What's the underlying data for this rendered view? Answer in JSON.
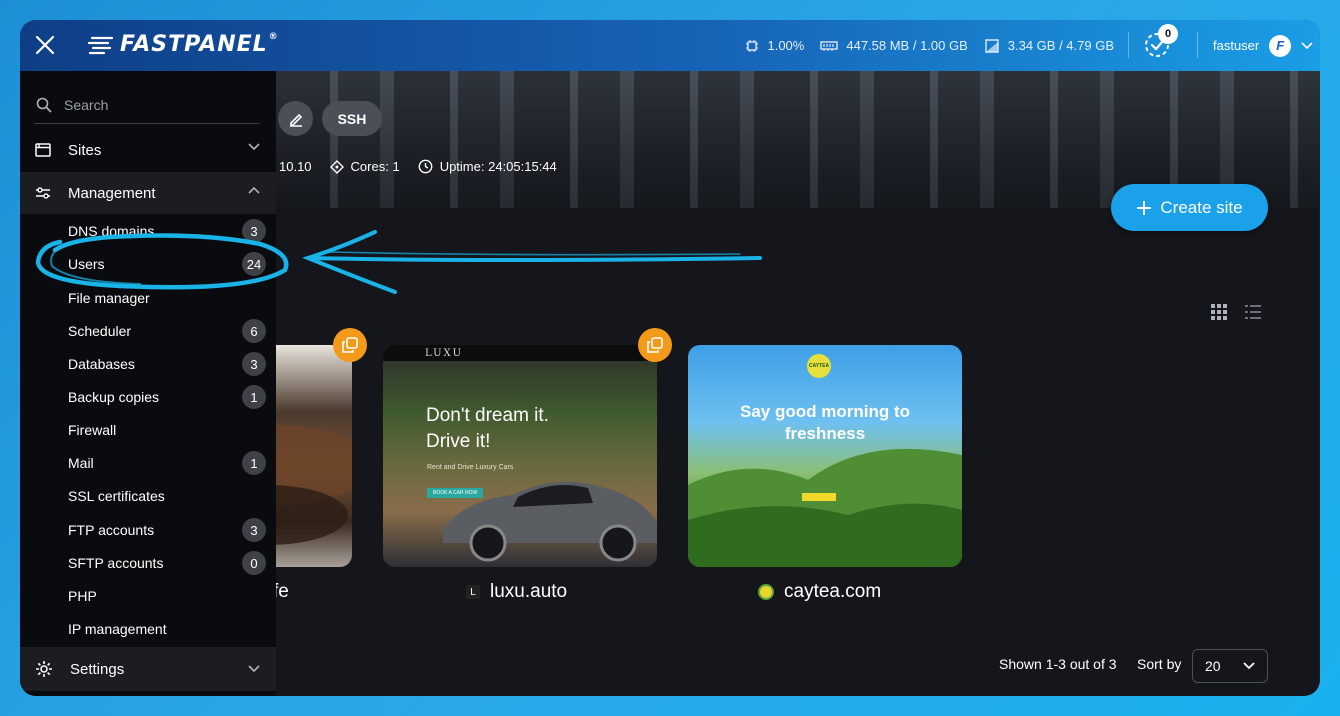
{
  "app": {
    "logo_text": "FASTPANEL",
    "logo_mark": "®"
  },
  "topbar": {
    "cpu": "1.00%",
    "ram": "447.58 MB / 1.00 GB",
    "disk": "3.34 GB / 4.79 GB",
    "tasks_count": "0",
    "username": "fastuser",
    "avatar_letter": "F"
  },
  "hero": {
    "ssh_label": "SSH",
    "ip_fragment": "10.10",
    "cores": "Cores: 1",
    "uptime": "Uptime: 24:05:15:44"
  },
  "sidebar": {
    "search_placeholder": "Search",
    "sites_label": "Sites",
    "management_label": "Management",
    "settings_label": "Settings",
    "items": [
      {
        "label": "DNS domains",
        "count": "3"
      },
      {
        "label": "Users",
        "count": "24"
      },
      {
        "label": "File manager",
        "count": ""
      },
      {
        "label": "Scheduler",
        "count": "6"
      },
      {
        "label": "Databases",
        "count": "3"
      },
      {
        "label": "Backup copies",
        "count": "1"
      },
      {
        "label": "Firewall",
        "count": ""
      },
      {
        "label": "Mail",
        "count": "1"
      },
      {
        "label": "SSL certificates",
        "count": ""
      },
      {
        "label": "FTP accounts",
        "count": "3"
      },
      {
        "label": "SFTP accounts",
        "count": "0"
      },
      {
        "label": "PHP",
        "count": ""
      },
      {
        "label": "IP management",
        "count": ""
      }
    ]
  },
  "main": {
    "create_site_label": "Create site",
    "sites": [
      {
        "name": "fe"
      },
      {
        "name": "luxu.auto",
        "headline": "Don't dream it. Drive it!",
        "brand": "LUXU",
        "subline": "Rent and Drive Luxury Cars",
        "cta": "BOOK A CAR NOW"
      },
      {
        "name": "caytea.com",
        "headline": "Say good morning to freshness",
        "brand": "CAYTEA"
      }
    ],
    "pagination_text": "Shown 1-3 out of 3",
    "sort_label": "Sort by",
    "sort_value": "20"
  },
  "colors": {
    "accent": "#1ba1ea",
    "badge": "#f39a1a",
    "sidebar_bg": "#0a0b0e",
    "annotation": "#19b3e8"
  }
}
